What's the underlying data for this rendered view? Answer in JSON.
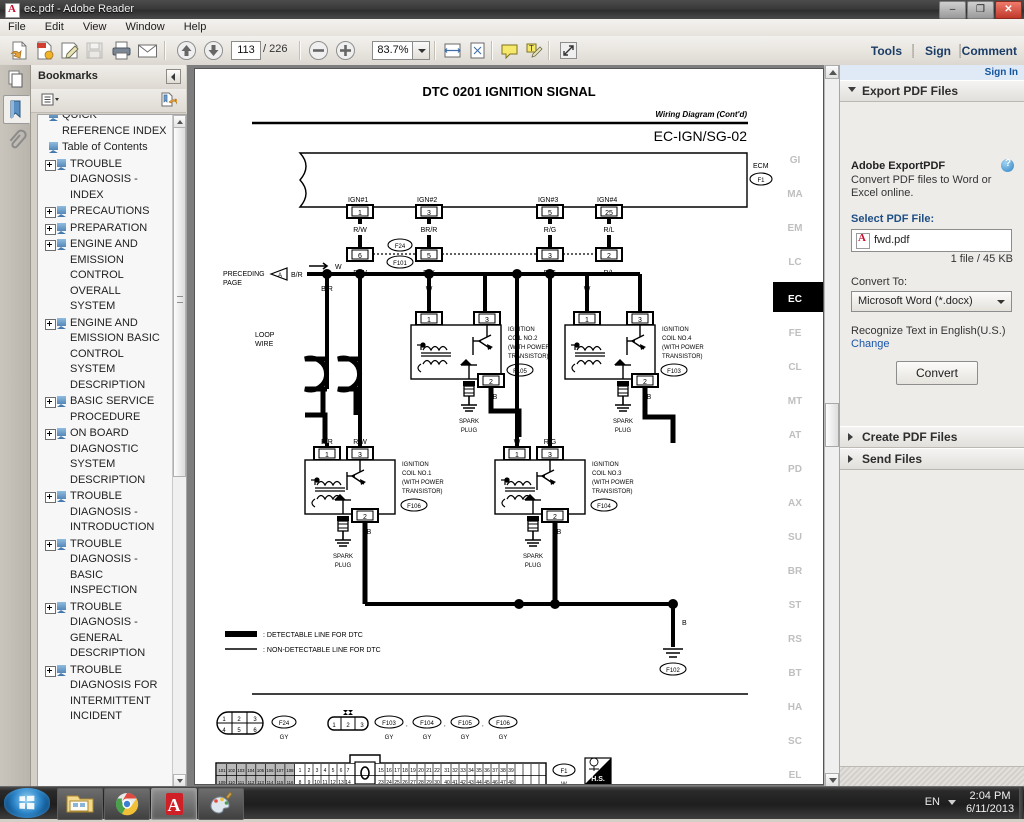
{
  "window": {
    "title": "ec.pdf - Adobe Reader",
    "app_icon": "pdf-icon",
    "controls": {
      "minimize": "–",
      "restore": "❐",
      "close": "✕"
    }
  },
  "menubar": {
    "items": [
      "File",
      "Edit",
      "View",
      "Window",
      "Help"
    ]
  },
  "toolbar": {
    "icons": [
      {
        "name": "open-pdf-icon"
      },
      {
        "name": "create-pdf-icon"
      },
      {
        "name": "edit-pdf-icon"
      },
      {
        "name": "save-icon"
      },
      {
        "name": "print-icon"
      },
      {
        "name": "email-icon"
      },
      {
        "name": "previous-page-icon"
      },
      {
        "name": "next-page-icon"
      },
      {
        "name": "zoom-out-icon"
      },
      {
        "name": "zoom-in-icon"
      },
      {
        "name": "fit-width-icon"
      },
      {
        "name": "fit-page-icon"
      },
      {
        "name": "sticky-note-icon"
      },
      {
        "name": "highlight-text-icon"
      },
      {
        "name": "full-screen-icon"
      }
    ],
    "page_number": "113",
    "page_total": "/ 226",
    "zoom_level": "83.7%",
    "right_links": [
      "Tools",
      "Sign",
      "Comment"
    ]
  },
  "navpane": {
    "rail": [
      "page-thumbnails-icon",
      "bookmarks-icon",
      "attachments-icon"
    ],
    "header_title": "Bookmarks",
    "options_icon": "bookmark-options-icon",
    "expand_icon": "expand-bookmarks-icon",
    "collapse_icon": "collapse-panel-icon",
    "bookmarks": [
      {
        "label": "QUICK REFERENCE INDEX",
        "expandable": false
      },
      {
        "label": "Table of Contents",
        "expandable": false
      },
      {
        "label": "TROUBLE DIAGNOSIS - INDEX",
        "expandable": true
      },
      {
        "label": "PRECAUTIONS",
        "expandable": true
      },
      {
        "label": "PREPARATION",
        "expandable": true
      },
      {
        "label": "ENGINE AND EMISSION CONTROL OVERALL SYSTEM",
        "expandable": true
      },
      {
        "label": "ENGINE AND EMISSION BASIC CONTROL SYSTEM DESCRIPTION",
        "expandable": true
      },
      {
        "label": "BASIC SERVICE PROCEDURE",
        "expandable": true
      },
      {
        "label": "ON BOARD DIAGNOSTIC SYSTEM DESCRIPTION",
        "expandable": true
      },
      {
        "label": "TROUBLE DIAGNOSIS - INTRODUCTION",
        "expandable": true
      },
      {
        "label": "TROUBLE DIAGNOSIS - BASIC INSPECTION",
        "expandable": true
      },
      {
        "label": "TROUBLE DIAGNOSIS - GENERAL DESCRIPTION",
        "expandable": true
      },
      {
        "label": "TROUBLE DIAGNOSIS FOR INTERMITTENT INCIDENT",
        "expandable": true
      }
    ]
  },
  "document": {
    "title": "DTC 0201 IGNITION SIGNAL",
    "subtitle": "Wiring Diagram (Cont'd)",
    "diagram_code": "EC-IGN/SG-02",
    "ecm": {
      "label": "ECM",
      "connector": "F1"
    },
    "ecm_pins": [
      {
        "signal": "IGN#1",
        "pin": "1",
        "wire": "R/W"
      },
      {
        "signal": "IGN#2",
        "pin": "3",
        "wire": "BR/R"
      },
      {
        "signal": "IGN#3",
        "pin": "5",
        "wire": "R/G"
      },
      {
        "signal": "IGN#4",
        "pin": "25",
        "wire": "R/L"
      }
    ],
    "inline_connector": {
      "upper": "F24",
      "lower": "F101"
    },
    "inline_pins": [
      {
        "pin": "6",
        "wire": "R/W"
      },
      {
        "pin": "5",
        "wire": "R/Y"
      },
      {
        "pin": "3",
        "wire": "R/G"
      },
      {
        "pin": "2",
        "wire": "R/L"
      }
    ],
    "preceding_page": {
      "text": "PRECEDING PAGE",
      "marker": "A",
      "wire_in": "B/R",
      "wire_out": "W"
    },
    "loop_wire_label": "LOOP WIRE",
    "branch_wires": [
      "B/R",
      "W",
      "B/R",
      "R/W",
      "W",
      "R/G"
    ],
    "coils": [
      {
        "name": "IGNITION COIL NO.2 (WITH POWER TRANSISTOR)",
        "connector": "F105",
        "pins": [
          "1",
          "3",
          "2"
        ],
        "in_wire": "W",
        "gnd_wire": "B",
        "plug": "SPARK PLUG"
      },
      {
        "name": "IGNITION COIL NO.4 (WITH POWER TRANSISTOR)",
        "connector": "F103",
        "pins": [
          "1",
          "3",
          "2"
        ],
        "in_wire": "W",
        "gnd_wire": "B",
        "plug": "SPARK PLUG"
      },
      {
        "name": "IGNITION COIL NO.1 (WITH POWER TRANSISTOR)",
        "connector": "F106",
        "pins": [
          "1",
          "3",
          "2"
        ],
        "in_wire": "B/R",
        "sig_wire": "R/W",
        "gnd_wire": "B",
        "plug": "SPARK PLUG"
      },
      {
        "name": "IGNITION COIL NO.3 (WITH POWER TRANSISTOR)",
        "connector": "F104",
        "pins": [
          "1",
          "3",
          "2"
        ],
        "in_wire": "W",
        "sig_wire": "R/G",
        "gnd_wire": "B",
        "plug": "SPARK PLUG"
      }
    ],
    "ground": {
      "wire": "B",
      "connector": "F102"
    },
    "legend": [
      ": DETECTABLE LINE FOR DTC",
      ": NON-DETECTABLE LINE FOR DTC"
    ],
    "connector_views": [
      {
        "id": "F24",
        "color": "GY",
        "pins_top": [
          "1",
          "2",
          "3"
        ],
        "pins_bottom": [
          "4",
          "5",
          "6"
        ]
      },
      {
        "id": "F103",
        "color": "GY"
      },
      {
        "id": "F104",
        "color": "GY"
      },
      {
        "id": "F105",
        "color": "GY"
      },
      {
        "id": "F106",
        "color": "GY"
      }
    ],
    "coil_connector_pins": [
      "1",
      "2",
      "3"
    ],
    "ecm_connector_view": {
      "id": "F1",
      "color": "W",
      "hs_label": "H.S.",
      "row1_shaded": [
        "101",
        "102",
        "103",
        "104",
        "105",
        "106",
        "107",
        "108"
      ],
      "row2_shaded": [
        "109",
        "110",
        "111",
        "112",
        "113",
        "114",
        "115",
        "116"
      ],
      "row1_a": [
        "1",
        "2",
        "3",
        "4",
        "5",
        "6",
        "7"
      ],
      "row2_a": [
        "8",
        "9",
        "10",
        "11",
        "12",
        "13",
        "14"
      ],
      "row1_b": [
        "15",
        "16",
        "17",
        "18",
        "19",
        "20",
        "21",
        "22"
      ],
      "row2_b": [
        "23",
        "24",
        "25",
        "26",
        "27",
        "28",
        "29",
        "30"
      ],
      "row1_c": [
        "31",
        "32",
        "33",
        "34",
        "35",
        "36",
        "37",
        "38",
        "39"
      ],
      "row2_c": [
        "40",
        "41",
        "42",
        "43",
        "44",
        "45",
        "46",
        "47",
        "48"
      ]
    },
    "section_tabs": [
      "GI",
      "MA",
      "EM",
      "LC",
      "EC",
      "FE",
      "CL",
      "MT",
      "AT",
      "PD",
      "AX",
      "SU",
      "BR",
      "ST",
      "RS",
      "BT",
      "HA",
      "SC",
      "EL"
    ],
    "active_section_tab": "EC"
  },
  "taskpane": {
    "signin": "Sign In",
    "sections": [
      {
        "title": "Export PDF Files",
        "expanded": true
      },
      {
        "title": "Create PDF Files",
        "expanded": false
      },
      {
        "title": "Send Files",
        "expanded": false
      }
    ],
    "export": {
      "heading": "Adobe ExportPDF",
      "help_icon": "help-icon",
      "description": "Convert PDF files to Word or Excel online.",
      "select_label": "Select PDF File:",
      "file_name": "fwd.pdf",
      "file_info": "1 file / 45 KB",
      "convert_label": "Convert To:",
      "convert_value": "Microsoft Word (*.docx)",
      "recognize_text": "Recognize Text in English(U.S.)",
      "change_link": "Change",
      "convert_button": "Convert"
    }
  },
  "taskbar": {
    "start": "start-orb-icon",
    "items": [
      {
        "name": "file-explorer-icon",
        "active": false
      },
      {
        "name": "google-chrome-icon",
        "active": false
      },
      {
        "name": "adobe-reader-icon",
        "active": true
      },
      {
        "name": "paint-icon",
        "active": false
      }
    ],
    "tray": {
      "language": "EN",
      "time": "2:04 PM",
      "date": "6/11/2013"
    }
  },
  "colors": {
    "accent_blue": "#14549e",
    "link_blue": "#1a55a8",
    "close_red": "#c0392b",
    "pdf_red": "#c8102e",
    "active_tab_bg": "#000000"
  }
}
